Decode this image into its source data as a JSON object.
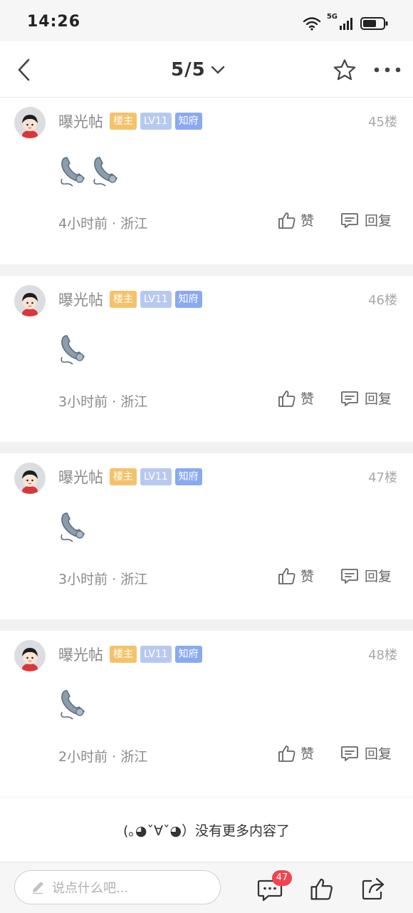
{
  "status_bar": {
    "time": "14:26",
    "network": "5G"
  },
  "nav": {
    "page_indicator": "5/5"
  },
  "posts": [
    {
      "username": "曝光帖",
      "badges": {
        "owner": "楼主",
        "level": "LV11",
        "rank": "知府"
      },
      "floor": "45楼",
      "emoji_count": 2,
      "time": "4小时前",
      "location": "浙江",
      "like_label": "赞",
      "reply_label": "回复"
    },
    {
      "username": "曝光帖",
      "badges": {
        "owner": "楼主",
        "level": "LV11",
        "rank": "知府"
      },
      "floor": "46楼",
      "emoji_count": 1,
      "time": "3小时前",
      "location": "浙江",
      "like_label": "赞",
      "reply_label": "回复"
    },
    {
      "username": "曝光帖",
      "badges": {
        "owner": "楼主",
        "level": "LV11",
        "rank": "知府"
      },
      "floor": "47楼",
      "emoji_count": 1,
      "time": "3小时前",
      "location": "浙江",
      "like_label": "赞",
      "reply_label": "回复"
    },
    {
      "username": "曝光帖",
      "badges": {
        "owner": "楼主",
        "level": "LV11",
        "rank": "知府"
      },
      "floor": "48楼",
      "emoji_count": 1,
      "time": "2小时前",
      "location": "浙江",
      "like_label": "赞",
      "reply_label": "回复"
    }
  ],
  "end_message": "(｡◕ˇ∀ˇ◕）没有更多内容了",
  "bottom_bar": {
    "input_placeholder": "说点什么吧...",
    "comment_count": "47"
  },
  "colors": {
    "badge_owner": "#f5c26b",
    "badge_level": "#b8c9f0",
    "badge_rank": "#8aaaf0",
    "count_badge": "#f2434f"
  }
}
